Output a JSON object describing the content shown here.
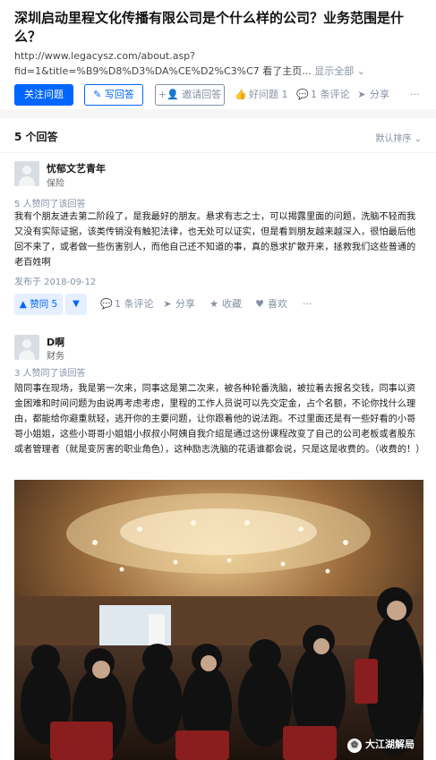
{
  "question": {
    "title": "深圳启动里程文化传播有限公司是个什么样的公司？业务范围是什么？",
    "url_text": "http://www.legacysz.com/about.asp?fid=1&title=%B9%D8%D3%DA%CE%D2%C3%C7 看了主页...",
    "show_all": "显示全部 ⌄",
    "follow_label": "关注问题",
    "write_label": "写回答",
    "invite_label": "邀请回答",
    "good_question": "好问题 1",
    "comments": "1 条评论",
    "share": "分享",
    "more": "···"
  },
  "answers_header": {
    "count": "5 个回答",
    "sort": "默认排序 ⌄"
  },
  "answers": [
    {
      "author": "忧郁文艺青年",
      "bio": "保险",
      "voters": "5 人赞同了该回答",
      "content": "我有个朋友进去第二阶段了，是我最好的朋友。悬求有志之士，可以揭露里面的问题，洗脑不轻而我又没有实际证据，该类传销没有触犯法律，也无处可以证实，但是看到朋友越来越深入，很怕最后他回不来了，或者做一些伤害别人，而他自己还不知道的事，真的恳求扩散开来，拯救我们这些普通的老百姓啊",
      "date": "发布于 2018-09-12",
      "vote_up": "▲ 赞同 5",
      "vote_down": "▼",
      "comments": "1 条评论",
      "share": "分享",
      "favorite": "收藏",
      "like": "喜欢",
      "more": "···"
    },
    {
      "author": "D啊",
      "bio": "财务",
      "voters": "3 人赞同了该回答",
      "content": "陪同事在现场，我是第一次来，同事这是第二次来，被各种轮番洗脑，被拉着去报名交钱，同事以资金困难和时间问题为由说再考虑考虑，里程的工作人员说可以先交定金，占个名额，不论你找什么理由，都能给你避重就轻，逃开你的主要问题，让你跟着他的说法跑。不过里面还是有一些好看的小哥哥小姐姐，这些小哥哥小姐姐小叔叔小阿姨自我介绍是通过这份课程改变了自己的公司老板或者股东或者管理者（就是变厉害的职业角色），这种励志洗脑的花语谁都会说，只是这是收费的。（收费的！）"
    }
  ],
  "photo": {
    "watermark": "大江湖解局"
  }
}
